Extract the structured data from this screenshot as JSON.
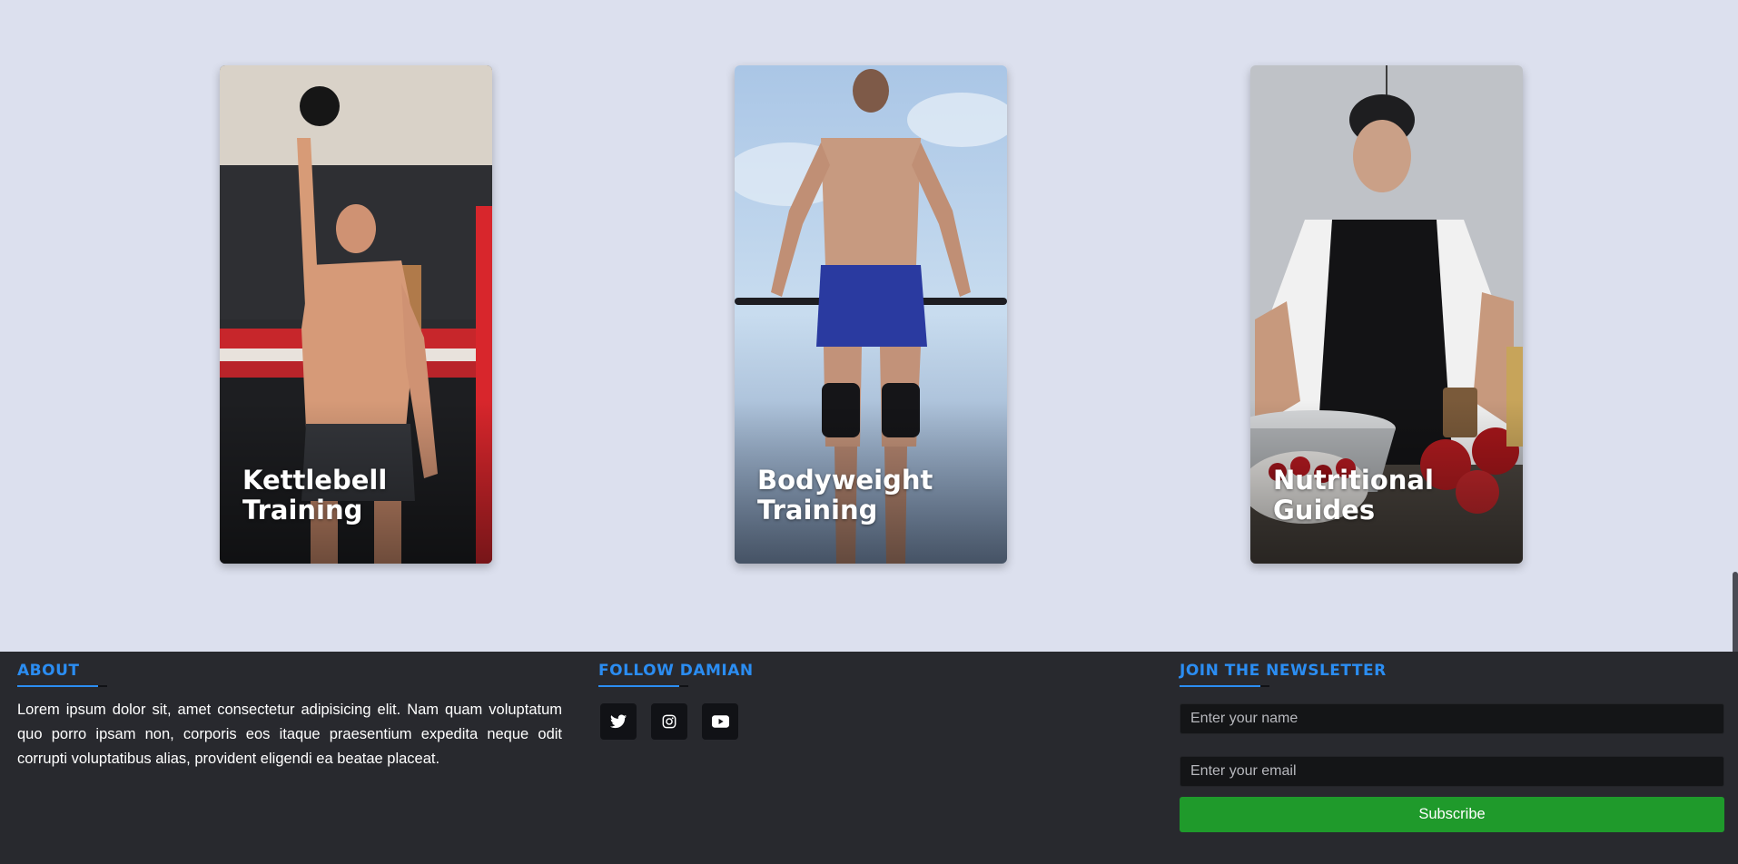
{
  "cards": [
    {
      "title": "Kettlebell Training"
    },
    {
      "title": "Bodyweight Training"
    },
    {
      "title": "Nutritional Guides"
    }
  ],
  "footer": {
    "about": {
      "heading": "ABOUT",
      "text": "Lorem ipsum dolor sit, amet consectetur adipisicing elit. Nam quam voluptatum quo porro ipsam non, corporis eos itaque praesentium expedita neque odit corrupti voluptatibus alias, provident eligendi ea beatae placeat."
    },
    "follow": {
      "heading": "FOLLOW DAMIAN",
      "icons": [
        "twitter-icon",
        "instagram-icon",
        "youtube-icon"
      ]
    },
    "newsletter": {
      "heading": "JOIN THE NEWSLETTER",
      "name_placeholder": "Enter your name",
      "email_placeholder": "Enter your email",
      "subscribe_label": "Subscribe"
    }
  },
  "colors": {
    "page_background": "#dce0ee",
    "footer_background": "#28292e",
    "accent_blue": "#2b8df2",
    "subscribe_green": "#1f9a2b"
  }
}
